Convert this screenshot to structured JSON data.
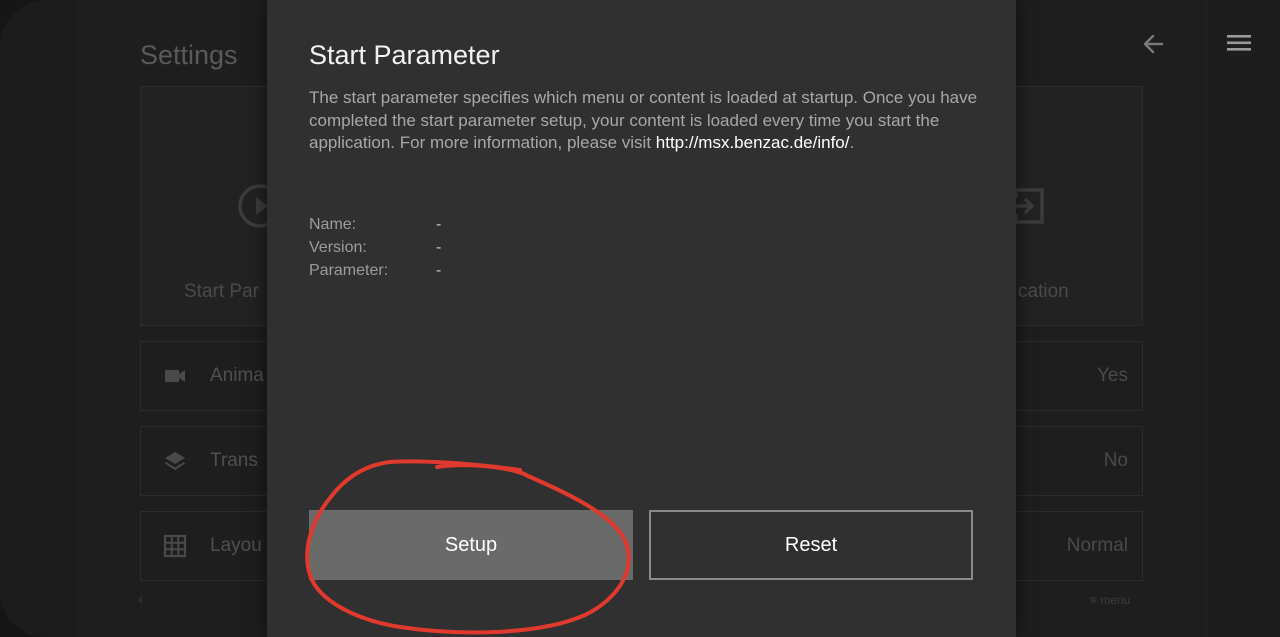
{
  "background": {
    "title": "Settings",
    "tiles": [
      {
        "label": "Start Par",
        "icon": "play-circle-icon"
      },
      {
        "label": "cation",
        "icon": "exit-box-icon"
      }
    ],
    "rows": [
      {
        "label": "Anima",
        "value": "Yes",
        "icon": "video-camera-icon"
      },
      {
        "label": "Trans",
        "value": "No",
        "icon": "layers-icon"
      },
      {
        "label": "Layou",
        "value": "Normal",
        "icon": "grid-icon"
      }
    ],
    "menu_hint": "≡ menu"
  },
  "dialog": {
    "title": "Start Parameter",
    "description": "The start parameter specifies which menu or content is loaded at startup. Once you have completed the start parameter setup, your content is loaded every time you start the application. For more information, please visit ",
    "link": "http://msx.benzac.de/info/",
    "description_end": ".",
    "info": [
      {
        "label": "Name:",
        "value": "-"
      },
      {
        "label": "Version:",
        "value": "-"
      },
      {
        "label": "Parameter:",
        "value": "-"
      }
    ],
    "setup_label": "Setup",
    "reset_label": "Reset"
  },
  "colors": {
    "dialog_bg": "#303030",
    "setup_bg": "#6a6a6a",
    "annotation_red": "#e03a2f"
  }
}
